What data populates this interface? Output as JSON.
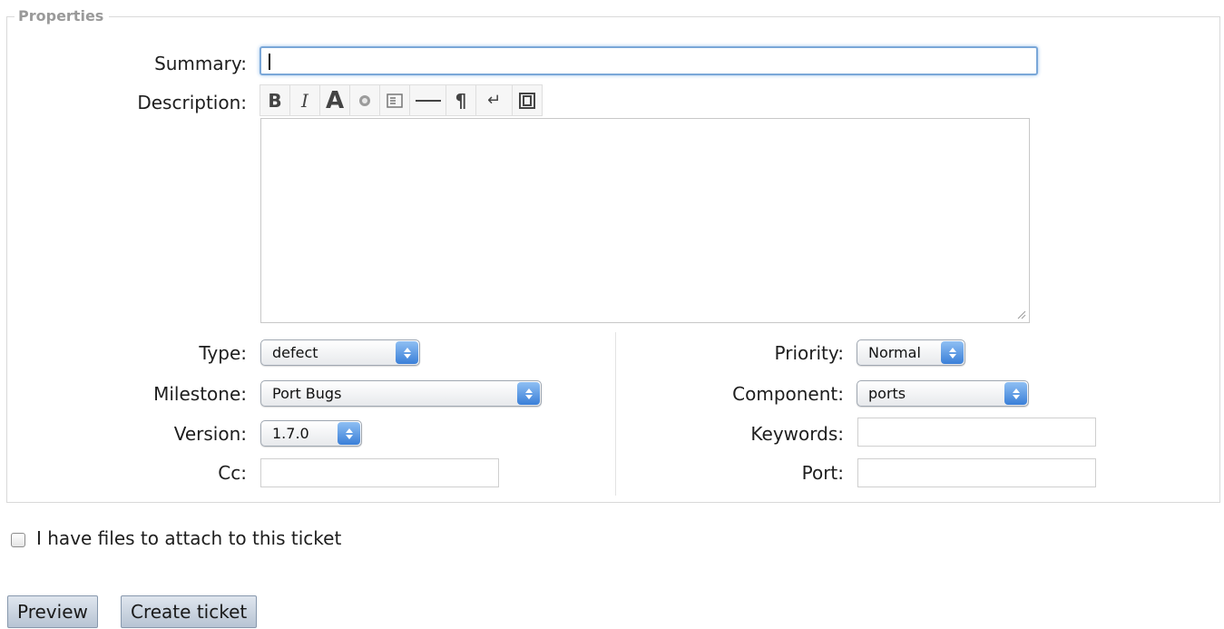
{
  "properties": {
    "legend": "Properties",
    "summary_label": "Summary:",
    "summary_value": "",
    "description_label": "Description:",
    "description_value": "",
    "toolbar": [
      {
        "name": "bold-button",
        "glyph": "B"
      },
      {
        "name": "italic-button",
        "glyph": "I"
      },
      {
        "name": "heading-button",
        "glyph": "A"
      },
      {
        "name": "link-button",
        "glyph": "◉"
      },
      {
        "name": "code-block-button",
        "glyph": "▤"
      },
      {
        "name": "horizontal-rule-button",
        "glyph": "—"
      },
      {
        "name": "paragraph-button",
        "glyph": "¶"
      },
      {
        "name": "line-break-button",
        "glyph": "↵"
      },
      {
        "name": "wiki-markup-button",
        "glyph": "⎍"
      }
    ],
    "type_label": "Type:",
    "type_value": "defect",
    "milestone_label": "Milestone:",
    "milestone_value": "Port Bugs",
    "version_label": "Version:",
    "version_value": "1.7.0",
    "cc_label": "Cc:",
    "cc_value": "",
    "priority_label": "Priority:",
    "priority_value": "Normal",
    "component_label": "Component:",
    "component_value": "ports",
    "keywords_label": "Keywords:",
    "keywords_value": "",
    "port_label": "Port:",
    "port_value": ""
  },
  "attach": {
    "label": "I have files to attach to this ticket",
    "checked": false
  },
  "buttons": {
    "preview": "Preview",
    "create": "Create ticket"
  },
  "colors": {
    "focus_ring": "#7aa7d8",
    "select_arrow": "#3a7fd8",
    "button_bg": "#c9d3df"
  }
}
